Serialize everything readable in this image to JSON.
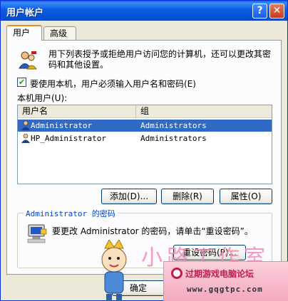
{
  "window": {
    "title": "用户帐户",
    "help_glyph": "?",
    "close_glyph": "✕"
  },
  "tabs": [
    {
      "label": "用户"
    },
    {
      "label": "高级"
    }
  ],
  "intro_text": "用下列表授予或拒绝用户访问您的计算机，还可以更改其密码和其他设置。",
  "require_login": {
    "label": "要使用本机，用户必须输入用户名和密码(E)",
    "checked": true
  },
  "users_label": "本机用户(U):",
  "list": {
    "columns": [
      "用户名",
      "组"
    ],
    "rows": [
      {
        "name": "Administrator",
        "group": "Administrators",
        "selected": true
      },
      {
        "name": "HP_Administrator",
        "group": "Administrators",
        "selected": false
      }
    ]
  },
  "buttons": {
    "add": "添加(D)...",
    "remove": "删除(R)",
    "properties": "属性(O)",
    "reset_password": "重设密码(P)...",
    "ok": "确定",
    "cancel": "取消"
  },
  "password_group": {
    "title": "Administrator 的密码",
    "text": "要更改 Administrator 的密码，请单击“重设密码”。"
  },
  "watermark": {
    "text": "小路工作室",
    "banner_name": "过期游戏电脑论坛",
    "url": "www.gqgtpc.com"
  },
  "icons": {
    "title_help": "help-icon",
    "title_close": "close-icon",
    "users": "users-icon",
    "user_row": "user-icon",
    "computer": "computer-icon",
    "check": "checkmark-icon"
  },
  "colors": {
    "titlebar": "#0a5fe0",
    "selection": "#316ac5",
    "tab_accent": "#e68b2c",
    "watermark_pink": "#f088b8"
  }
}
